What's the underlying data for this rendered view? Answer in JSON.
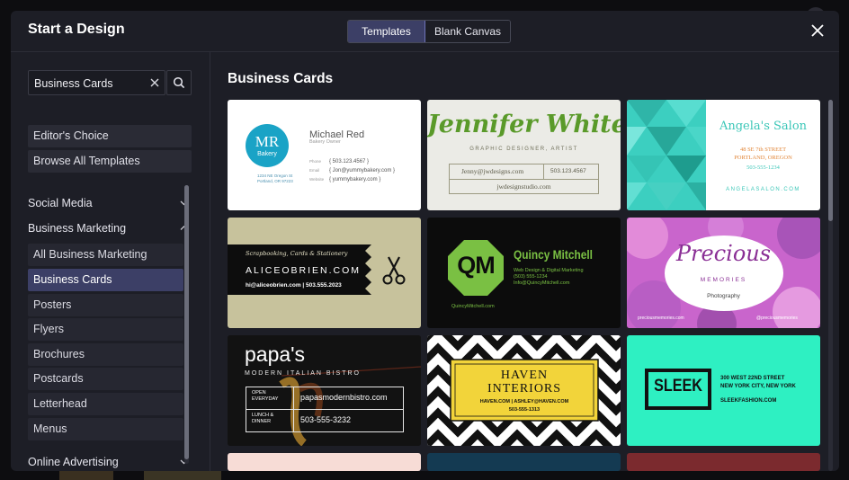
{
  "dialog": {
    "title": "Start a Design",
    "tabs": [
      {
        "label": "Templates",
        "active": true
      },
      {
        "label": "Blank Canvas",
        "active": false
      }
    ],
    "close_icon": "close-icon"
  },
  "sidebar": {
    "search": {
      "value": "Business Cards",
      "clear_icon": "close-icon",
      "search_icon": "search-icon"
    },
    "quick_links": [
      "Editor's Choice",
      "Browse All Templates"
    ],
    "categories": [
      {
        "label": "Social Media",
        "expanded": false
      },
      {
        "label": "Business Marketing",
        "expanded": true
      },
      {
        "label": "Online Advertising",
        "expanded": false
      }
    ],
    "subcategories": [
      {
        "label": "All Business Marketing",
        "active": false
      },
      {
        "label": "Business Cards",
        "active": true
      },
      {
        "label": "Posters",
        "active": false
      },
      {
        "label": "Flyers",
        "active": false
      },
      {
        "label": "Brochures",
        "active": false
      },
      {
        "label": "Postcards",
        "active": false
      },
      {
        "label": "Letterhead",
        "active": false
      },
      {
        "label": "Menus",
        "active": false
      }
    ]
  },
  "main": {
    "section_title": "Business Cards",
    "templates": [
      {
        "id": "mr-bakery",
        "logo": "MR",
        "logo_sub": "Bakery",
        "address": "1234 NE Oregon St\nPortland, OR 97223",
        "name": "Michael Red",
        "role": "Bakery Owner",
        "phone_label": "Phone",
        "phone": "{ 503.123.4567 }",
        "email_label": "Email",
        "email": "{ Jon@yummybakery.com }",
        "website_label": "Website",
        "website": "{ yummybakery.com }"
      },
      {
        "id": "jennifer-white",
        "name": "Jennifer White",
        "role": "GRAPHIC DESIGNER, ARTIST",
        "email": "Jenny@jwdesigns.com",
        "phone": "503.123.4567",
        "website": "jwdesignstudio.com"
      },
      {
        "id": "angelas-salon",
        "name": "Angela's Salon",
        "street": "48 SE 7th STREET",
        "city": "PORTLAND, OREGON",
        "phone": "503-555-1234",
        "website": "ANGELASALON.COM"
      },
      {
        "id": "alice-obrien",
        "tagline": "Scrapbooking, Cards & Stationery",
        "website": "ALICEOBRIEN.COM",
        "contact": "hi@aliceobrien.com  |  503.555.2023",
        "icon": "scissors-icon"
      },
      {
        "id": "quincy-mitchell",
        "logo": "QM",
        "name": "Quincy Mitchell",
        "role": "Web Design & Digital Marketing",
        "phone": "(503) 555-1234",
        "email": "Info@QuincyMitchell.com",
        "website": "QuincyMitchell.com"
      },
      {
        "id": "precious-memories",
        "title": "Precious",
        "subtitle": "MEMORIES",
        "role": "Photography",
        "website": "preciousmemories.com",
        "social": "@preciousmemories"
      },
      {
        "id": "papas",
        "name": "papa's",
        "subtitle": "MODERN ITALIAN BISTRO",
        "hours1": "OPEN\nEVERYDAY",
        "hours2": "LUNCH &\nDINNER",
        "website": "papasmodernbistro.com",
        "phone": "503-555-3232"
      },
      {
        "id": "haven-interiors",
        "line1": "HAVEN",
        "line2": "INTERIORS",
        "contact": "HAVEN.COM  |  ASHLEY@HAVEN.COM",
        "phone": "503-555-1313"
      },
      {
        "id": "sleek",
        "logo": "SLEEK",
        "address1": "300 WEST 22ND STREET",
        "address2": "NEW YORK CITY, NEW YORK",
        "website": "SLEEKFASHION.COM"
      }
    ]
  },
  "colors": {
    "modal_bg": "#1d1e26",
    "accent": "#3c3f66",
    "mr_teal": "#1aa3c6",
    "jw_green": "#5a9a2a",
    "salon_teal": "#3ccfc0",
    "alice_khaki": "#c7c29c",
    "qm_green": "#7ac043",
    "precious_pink": "#d97ad6",
    "haven_yellow": "#f2d43a",
    "sleek_mint": "#2ef0c2"
  }
}
